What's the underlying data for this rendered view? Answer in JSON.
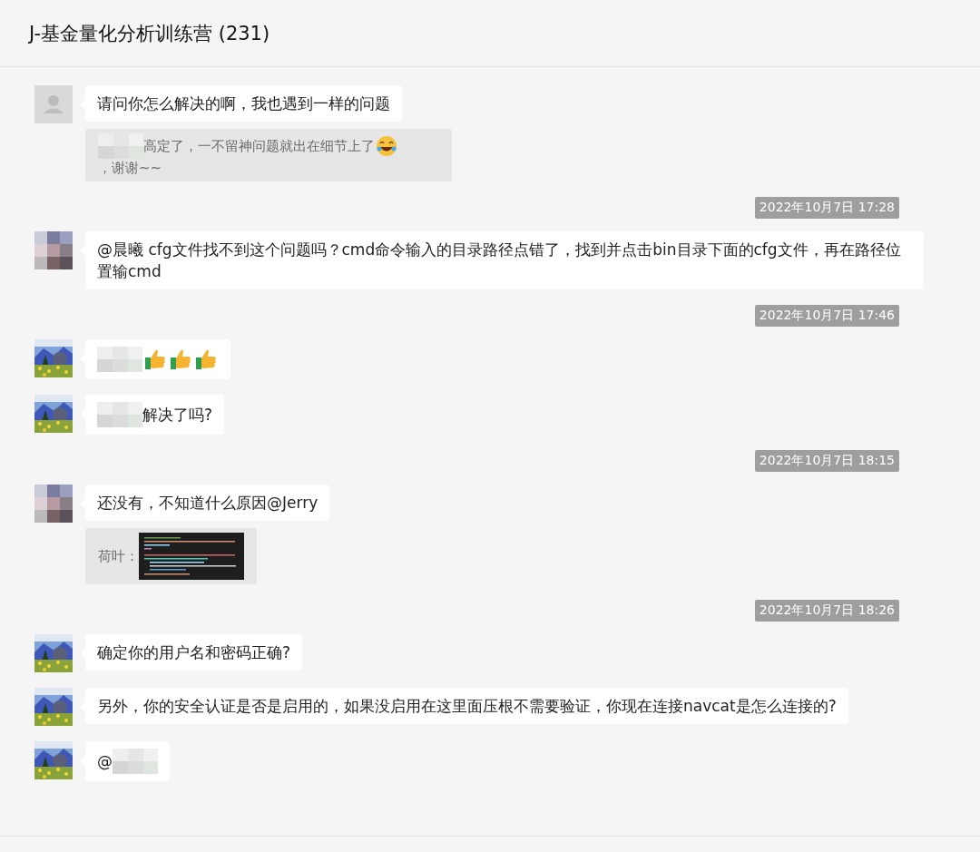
{
  "title": "J-基金量化分析训练营 (231)",
  "feed": [
    {
      "kind": "message",
      "avatar": {
        "kind": "placeholder"
      },
      "parts": [
        {
          "kind": "text",
          "text": "请问你怎么解决的啊，我也遇到一样的问题"
        }
      ],
      "quote": [
        {
          "kind": "blur"
        },
        {
          "kind": "text",
          "text": "高定了，一不留神问题就出在细节上了"
        },
        {
          "kind": "laugh"
        },
        {
          "kind": "text",
          "text": "，谢谢~~"
        }
      ]
    },
    {
      "kind": "timestamp",
      "text": "2022年10月7日 17:28"
    },
    {
      "kind": "message",
      "avatar": {
        "kind": "mosaic"
      },
      "parts": [
        {
          "kind": "text",
          "text": "@晨曦 cfg文件找不到这个问题吗？cmd命令输入的目录路径点错了，找到并点击bin目录下面的cfg文件，再在路径位置输cmd"
        }
      ]
    },
    {
      "kind": "timestamp",
      "text": "2022年10月7日 17:46"
    },
    {
      "kind": "message",
      "avatar": {
        "kind": "landscape"
      },
      "parts": [
        {
          "kind": "blur"
        },
        {
          "kind": "thumbs"
        },
        {
          "kind": "thumbs"
        },
        {
          "kind": "thumbs"
        }
      ]
    },
    {
      "kind": "message",
      "avatar": {
        "kind": "landscape"
      },
      "parts": [
        {
          "kind": "blur"
        },
        {
          "kind": "text",
          "text": "解决了吗?"
        }
      ]
    },
    {
      "kind": "timestamp",
      "text": "2022年10月7日 18:15"
    },
    {
      "kind": "message",
      "avatar": {
        "kind": "mosaic"
      },
      "parts": [
        {
          "kind": "text",
          "text": "还没有，不知道什么原因@Jerry"
        }
      ],
      "quote": [
        {
          "kind": "text",
          "text": "荷叶："
        },
        {
          "kind": "code"
        }
      ]
    },
    {
      "kind": "timestamp",
      "text": "2022年10月7日 18:26"
    },
    {
      "kind": "message",
      "avatar": {
        "kind": "landscape"
      },
      "parts": [
        {
          "kind": "text",
          "text": "确定你的用户名和密码正确?"
        }
      ]
    },
    {
      "kind": "message",
      "avatar": {
        "kind": "landscape"
      },
      "parts": [
        {
          "kind": "text",
          "text": "另外，你的安全认证是否是启用的，如果没启用在这里面压根不需要验证，你现在连接navcat是怎么连接的?"
        }
      ]
    },
    {
      "kind": "message",
      "avatar": {
        "kind": "landscape"
      },
      "parts": [
        {
          "kind": "text",
          "text": "@"
        },
        {
          "kind": "blur"
        }
      ]
    }
  ]
}
